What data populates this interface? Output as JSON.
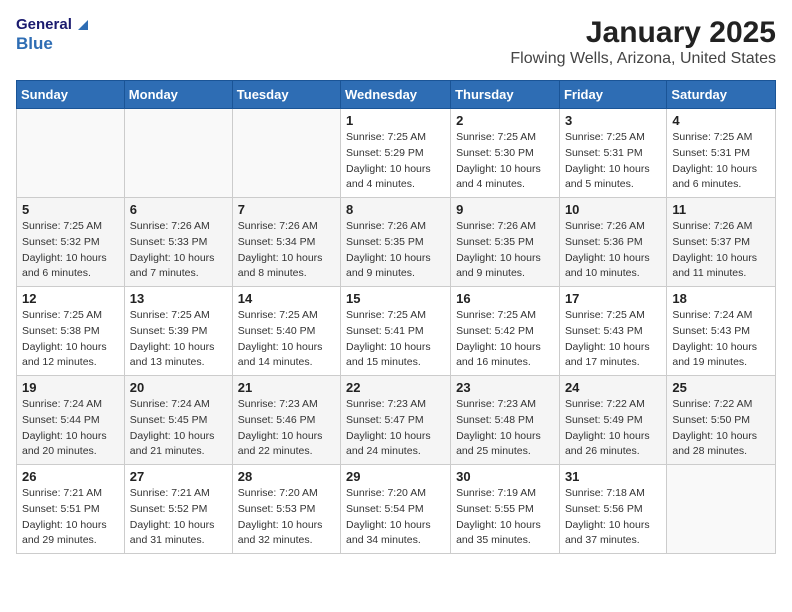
{
  "header": {
    "logo_general": "General",
    "logo_blue": "Blue",
    "title": "January 2025",
    "subtitle": "Flowing Wells, Arizona, United States"
  },
  "days_of_week": [
    "Sunday",
    "Monday",
    "Tuesday",
    "Wednesday",
    "Thursday",
    "Friday",
    "Saturday"
  ],
  "weeks": [
    [
      {
        "day": "",
        "sunrise": "",
        "sunset": "",
        "daylight": ""
      },
      {
        "day": "",
        "sunrise": "",
        "sunset": "",
        "daylight": ""
      },
      {
        "day": "",
        "sunrise": "",
        "sunset": "",
        "daylight": ""
      },
      {
        "day": "1",
        "sunrise": "Sunrise: 7:25 AM",
        "sunset": "Sunset: 5:29 PM",
        "daylight": "Daylight: 10 hours and 4 minutes."
      },
      {
        "day": "2",
        "sunrise": "Sunrise: 7:25 AM",
        "sunset": "Sunset: 5:30 PM",
        "daylight": "Daylight: 10 hours and 4 minutes."
      },
      {
        "day": "3",
        "sunrise": "Sunrise: 7:25 AM",
        "sunset": "Sunset: 5:31 PM",
        "daylight": "Daylight: 10 hours and 5 minutes."
      },
      {
        "day": "4",
        "sunrise": "Sunrise: 7:25 AM",
        "sunset": "Sunset: 5:31 PM",
        "daylight": "Daylight: 10 hours and 6 minutes."
      }
    ],
    [
      {
        "day": "5",
        "sunrise": "Sunrise: 7:25 AM",
        "sunset": "Sunset: 5:32 PM",
        "daylight": "Daylight: 10 hours and 6 minutes."
      },
      {
        "day": "6",
        "sunrise": "Sunrise: 7:26 AM",
        "sunset": "Sunset: 5:33 PM",
        "daylight": "Daylight: 10 hours and 7 minutes."
      },
      {
        "day": "7",
        "sunrise": "Sunrise: 7:26 AM",
        "sunset": "Sunset: 5:34 PM",
        "daylight": "Daylight: 10 hours and 8 minutes."
      },
      {
        "day": "8",
        "sunrise": "Sunrise: 7:26 AM",
        "sunset": "Sunset: 5:35 PM",
        "daylight": "Daylight: 10 hours and 9 minutes."
      },
      {
        "day": "9",
        "sunrise": "Sunrise: 7:26 AM",
        "sunset": "Sunset: 5:35 PM",
        "daylight": "Daylight: 10 hours and 9 minutes."
      },
      {
        "day": "10",
        "sunrise": "Sunrise: 7:26 AM",
        "sunset": "Sunset: 5:36 PM",
        "daylight": "Daylight: 10 hours and 10 minutes."
      },
      {
        "day": "11",
        "sunrise": "Sunrise: 7:26 AM",
        "sunset": "Sunset: 5:37 PM",
        "daylight": "Daylight: 10 hours and 11 minutes."
      }
    ],
    [
      {
        "day": "12",
        "sunrise": "Sunrise: 7:25 AM",
        "sunset": "Sunset: 5:38 PM",
        "daylight": "Daylight: 10 hours and 12 minutes."
      },
      {
        "day": "13",
        "sunrise": "Sunrise: 7:25 AM",
        "sunset": "Sunset: 5:39 PM",
        "daylight": "Daylight: 10 hours and 13 minutes."
      },
      {
        "day": "14",
        "sunrise": "Sunrise: 7:25 AM",
        "sunset": "Sunset: 5:40 PM",
        "daylight": "Daylight: 10 hours and 14 minutes."
      },
      {
        "day": "15",
        "sunrise": "Sunrise: 7:25 AM",
        "sunset": "Sunset: 5:41 PM",
        "daylight": "Daylight: 10 hours and 15 minutes."
      },
      {
        "day": "16",
        "sunrise": "Sunrise: 7:25 AM",
        "sunset": "Sunset: 5:42 PM",
        "daylight": "Daylight: 10 hours and 16 minutes."
      },
      {
        "day": "17",
        "sunrise": "Sunrise: 7:25 AM",
        "sunset": "Sunset: 5:43 PM",
        "daylight": "Daylight: 10 hours and 17 minutes."
      },
      {
        "day": "18",
        "sunrise": "Sunrise: 7:24 AM",
        "sunset": "Sunset: 5:43 PM",
        "daylight": "Daylight: 10 hours and 19 minutes."
      }
    ],
    [
      {
        "day": "19",
        "sunrise": "Sunrise: 7:24 AM",
        "sunset": "Sunset: 5:44 PM",
        "daylight": "Daylight: 10 hours and 20 minutes."
      },
      {
        "day": "20",
        "sunrise": "Sunrise: 7:24 AM",
        "sunset": "Sunset: 5:45 PM",
        "daylight": "Daylight: 10 hours and 21 minutes."
      },
      {
        "day": "21",
        "sunrise": "Sunrise: 7:23 AM",
        "sunset": "Sunset: 5:46 PM",
        "daylight": "Daylight: 10 hours and 22 minutes."
      },
      {
        "day": "22",
        "sunrise": "Sunrise: 7:23 AM",
        "sunset": "Sunset: 5:47 PM",
        "daylight": "Daylight: 10 hours and 24 minutes."
      },
      {
        "day": "23",
        "sunrise": "Sunrise: 7:23 AM",
        "sunset": "Sunset: 5:48 PM",
        "daylight": "Daylight: 10 hours and 25 minutes."
      },
      {
        "day": "24",
        "sunrise": "Sunrise: 7:22 AM",
        "sunset": "Sunset: 5:49 PM",
        "daylight": "Daylight: 10 hours and 26 minutes."
      },
      {
        "day": "25",
        "sunrise": "Sunrise: 7:22 AM",
        "sunset": "Sunset: 5:50 PM",
        "daylight": "Daylight: 10 hours and 28 minutes."
      }
    ],
    [
      {
        "day": "26",
        "sunrise": "Sunrise: 7:21 AM",
        "sunset": "Sunset: 5:51 PM",
        "daylight": "Daylight: 10 hours and 29 minutes."
      },
      {
        "day": "27",
        "sunrise": "Sunrise: 7:21 AM",
        "sunset": "Sunset: 5:52 PM",
        "daylight": "Daylight: 10 hours and 31 minutes."
      },
      {
        "day": "28",
        "sunrise": "Sunrise: 7:20 AM",
        "sunset": "Sunset: 5:53 PM",
        "daylight": "Daylight: 10 hours and 32 minutes."
      },
      {
        "day": "29",
        "sunrise": "Sunrise: 7:20 AM",
        "sunset": "Sunset: 5:54 PM",
        "daylight": "Daylight: 10 hours and 34 minutes."
      },
      {
        "day": "30",
        "sunrise": "Sunrise: 7:19 AM",
        "sunset": "Sunset: 5:55 PM",
        "daylight": "Daylight: 10 hours and 35 minutes."
      },
      {
        "day": "31",
        "sunrise": "Sunrise: 7:18 AM",
        "sunset": "Sunset: 5:56 PM",
        "daylight": "Daylight: 10 hours and 37 minutes."
      },
      {
        "day": "",
        "sunrise": "",
        "sunset": "",
        "daylight": ""
      }
    ]
  ]
}
